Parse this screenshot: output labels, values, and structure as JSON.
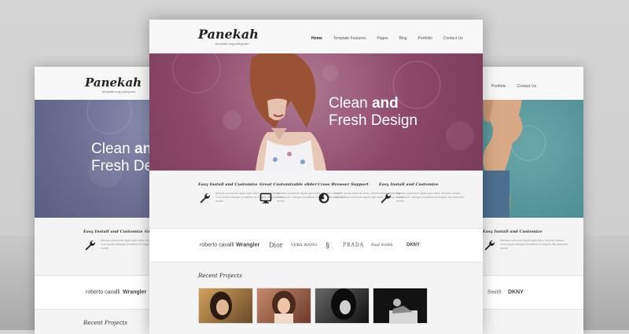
{
  "logo": {
    "name": "Panekah",
    "tagline": "template.eng.paling.see"
  },
  "nav": [
    "Home",
    "Template Features",
    "Pages",
    "Blog",
    "Portfolio",
    "Contact Us"
  ],
  "right_nav": [
    "Portfolio",
    "Contact Us"
  ],
  "hero": {
    "line1": "Clean",
    "line1_bold": "and",
    "line2": "Fresh Design"
  },
  "left_hero": {
    "line1": "Clean",
    "line1_bold": "and",
    "line2": "Fresh De"
  },
  "features": [
    {
      "title": "Easy Install and Customize",
      "icon": "wrench-icon",
      "body": "Aenean commodo ligula eget dolor. Aenean massa. Cum sociis natoque penatibus et magnis dis parturient monte"
    },
    {
      "title": "Great Customizable slider",
      "icon": "monitor-icon",
      "body": "Aenean commodo ligula eget dolor. Aenean massa. Cum sociis natoque penatibus et magnis dis parturient monte"
    },
    {
      "title": "Cross Browser Support",
      "icon": "firefox-icon",
      "body": "Lorem ipsum dolor sit amet, consectetuer adipiscing elit. Aenean commodo ligula eget dolor. Aenean massa"
    },
    {
      "title": "Easy Install and Customize",
      "icon": "wrench-icon",
      "body": "Aenean commodo ligula eget dolor. Aenean massa. Cum sociis natoque penatibus et magnis dis parturient monte"
    }
  ],
  "left_feature": {
    "title": "Easy Install and Customize",
    "title_cut": "Gr",
    "body": "Aenean commodo ligula eget dolor. Aenean massa. Cum sociis natoque penatibus et magnis dis parturient monte"
  },
  "right_feature": {
    "title": "Easy Install and Customize",
    "body": "Aenean commodo ligula eget dolor. Aenean massa. Cum sociis natoque penatibus et magnis dis parturient monte"
  },
  "brands": [
    "roberto cavalli",
    "Wrangler",
    "Dior",
    "VERA WANG",
    "§",
    "PRADA",
    "Paul Smith",
    "DKNY"
  ],
  "left_brands": [
    "roberto cavalli",
    "Wrangler"
  ],
  "right_brands": [
    "Smith",
    "DKNY"
  ],
  "recent_projects": "Recent Projects",
  "colors": {
    "hero_center": "#8d4869",
    "hero_left": "#6a6e92",
    "hero_right": "#4d8f94"
  }
}
